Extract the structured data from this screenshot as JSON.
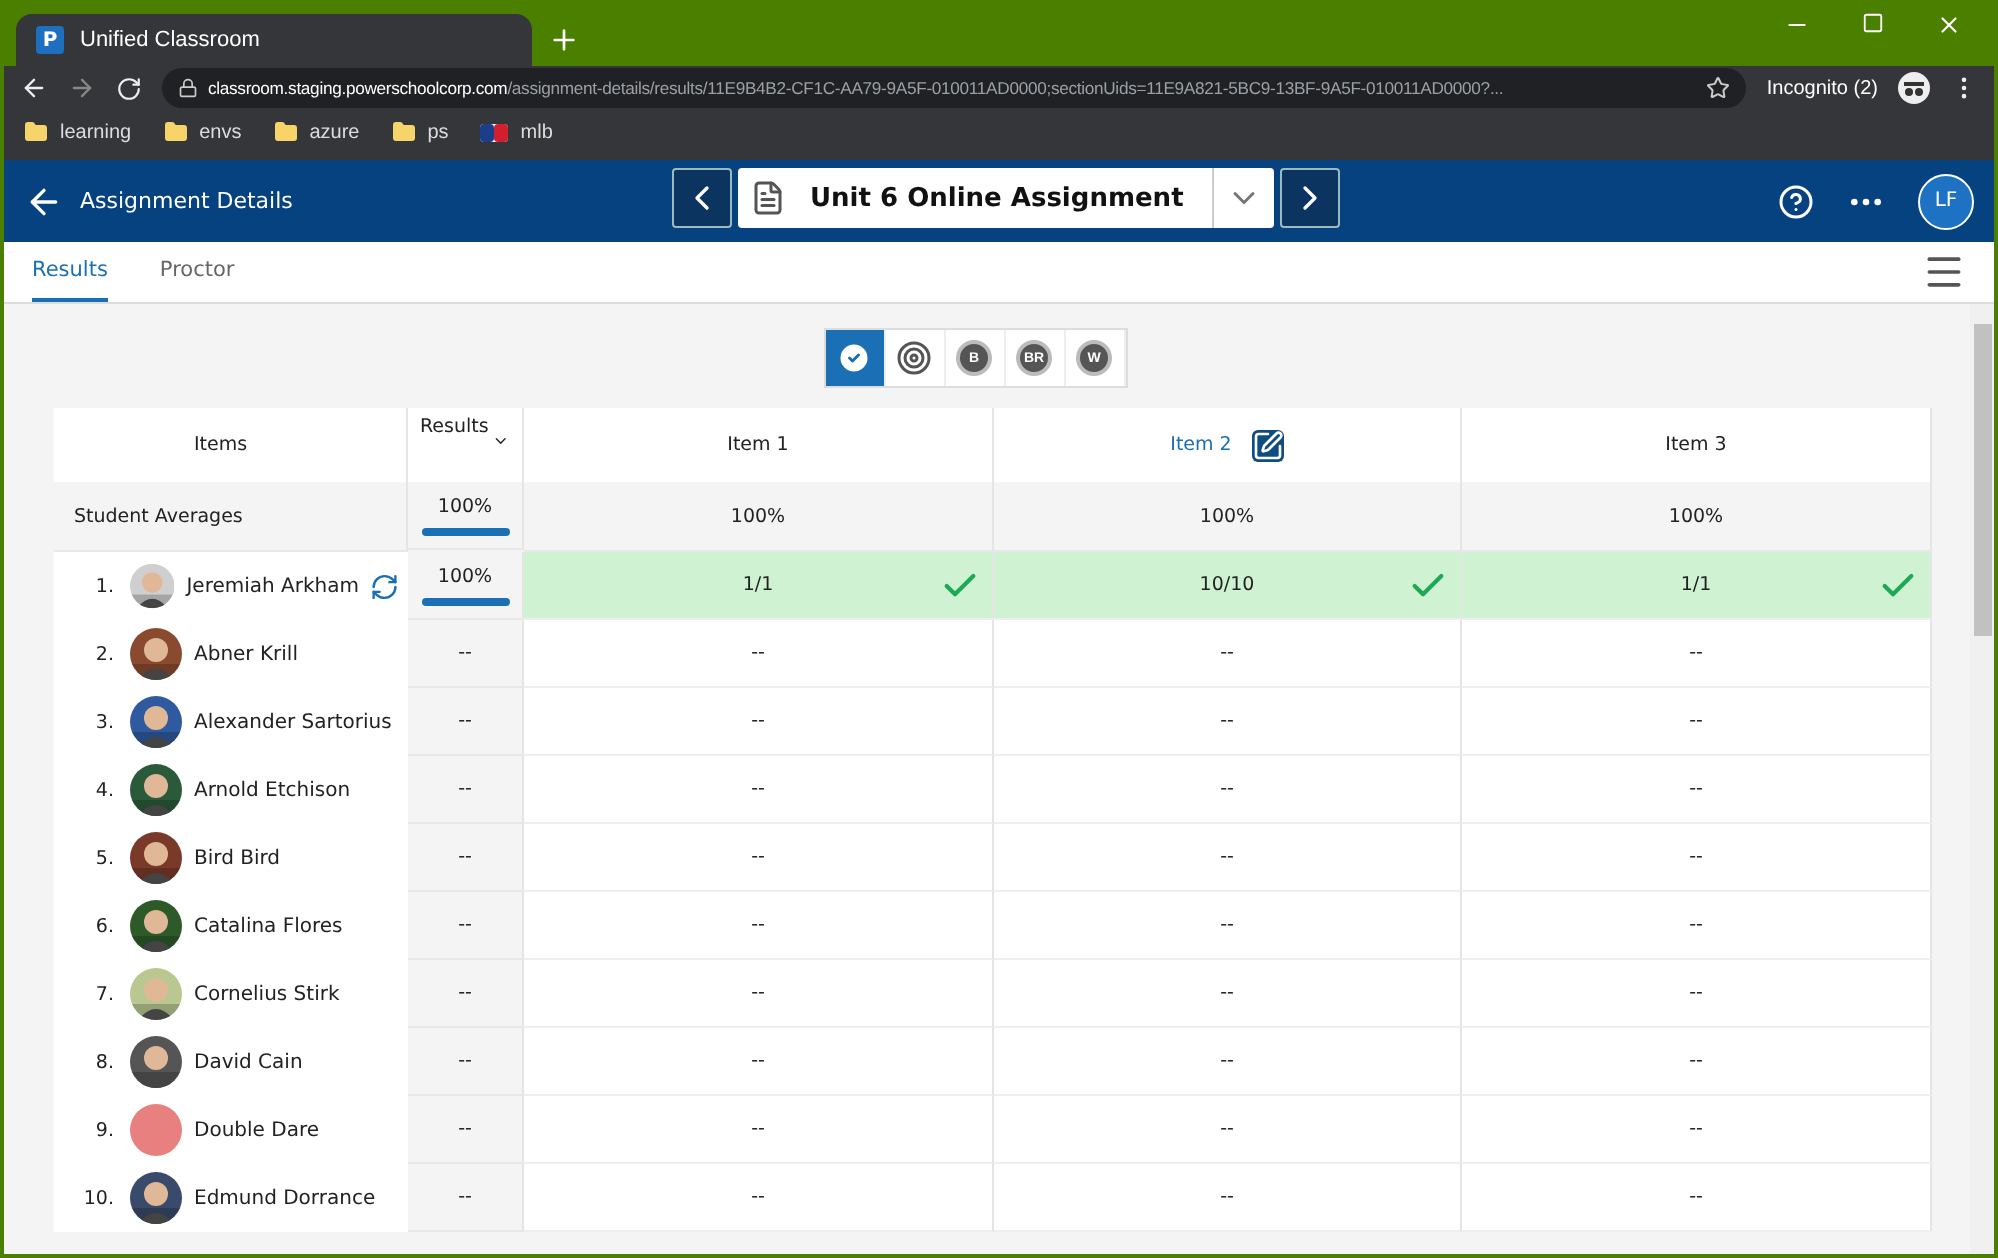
{
  "browser": {
    "tab_title": "Unified Classroom",
    "favicon": "P",
    "url_host": "classroom.staging.powerschoolcorp.com",
    "url_path": "/assignment-details/results/11E9B4B2-CF1C-AA79-9A5F-010011AD0000;sectionUids=11E9A821-5BC9-13BF-9A5F-010011AD0000?...",
    "incognito": "Incognito (2)",
    "bookmarks": [
      {
        "label": "learning",
        "kind": "folder"
      },
      {
        "label": "envs",
        "kind": "folder"
      },
      {
        "label": "azure",
        "kind": "folder"
      },
      {
        "label": "ps",
        "kind": "folder"
      },
      {
        "label": "mlb",
        "kind": "logo"
      }
    ]
  },
  "header": {
    "back_label": "Assignment Details",
    "assignment": "Unit 6 Online Assignment",
    "avatar": "LF"
  },
  "tabs": [
    {
      "label": "Results",
      "selected": true
    },
    {
      "label": "Proctor",
      "selected": false
    }
  ],
  "view_buttons": [
    {
      "kind": "check",
      "selected": true
    },
    {
      "kind": "target",
      "selected": false
    },
    {
      "kind": "letter",
      "label": "B",
      "selected": false
    },
    {
      "kind": "letter",
      "label": "BR",
      "selected": false
    },
    {
      "kind": "letter",
      "label": "W",
      "selected": false
    }
  ],
  "table": {
    "columns": [
      {
        "kind": "number"
      },
      {
        "label": "Items"
      },
      {
        "label": "Results"
      },
      {
        "label": "Item 1",
        "editable": false
      },
      {
        "label": "Item 2",
        "editable": true
      },
      {
        "label": "Item 3",
        "editable": false
      }
    ],
    "averages": {
      "label": "Student Averages",
      "result": "100%",
      "level": 1,
      "items": [
        "100%",
        "100%",
        "100%"
      ]
    },
    "rows": [
      {
        "number": "1.",
        "name": "Jeremiah Arkham",
        "retry": true,
        "result": "100%",
        "level": 1,
        "completed": true,
        "cells": [
          {
            "score": "1/1",
            "correct": true
          },
          {
            "score": "10/10",
            "correct": true
          },
          {
            "score": "1/1",
            "correct": true
          }
        ]
      },
      {
        "number": "2.",
        "name": "Abner Krill",
        "retry": false,
        "result": "--",
        "completed": false,
        "cells": [
          {
            "score": "--",
            "correct": false
          },
          {
            "score": "--",
            "correct": false
          },
          {
            "score": "--",
            "correct": false
          }
        ]
      },
      {
        "number": "3.",
        "name": "Alexander Sartorius",
        "retry": false,
        "result": "--",
        "completed": false,
        "cells": [
          {
            "score": "--",
            "correct": false
          },
          {
            "score": "--",
            "correct": false
          },
          {
            "score": "--",
            "correct": false
          }
        ]
      },
      {
        "number": "4.",
        "name": "Arnold Etchison",
        "retry": false,
        "result": "--",
        "completed": false,
        "cells": [
          {
            "score": "--",
            "correct": false
          },
          {
            "score": "--",
            "correct": false
          },
          {
            "score": "--",
            "correct": false
          }
        ]
      },
      {
        "number": "5.",
        "name": "Bird Bird",
        "retry": false,
        "result": "--",
        "completed": false,
        "cells": [
          {
            "score": "--",
            "correct": false
          },
          {
            "score": "--",
            "correct": false
          },
          {
            "score": "--",
            "correct": false
          }
        ]
      },
      {
        "number": "6.",
        "name": "Catalina Flores",
        "retry": false,
        "result": "--",
        "completed": false,
        "cells": [
          {
            "score": "--",
            "correct": false
          },
          {
            "score": "--",
            "correct": false
          },
          {
            "score": "--",
            "correct": false
          }
        ]
      },
      {
        "number": "7.",
        "name": "Cornelius Stirk",
        "retry": false,
        "result": "--",
        "completed": false,
        "cells": [
          {
            "score": "--",
            "correct": false
          },
          {
            "score": "--",
            "correct": false
          },
          {
            "score": "--",
            "correct": false
          }
        ]
      },
      {
        "number": "8.",
        "name": "David Cain",
        "retry": false,
        "result": "--",
        "completed": false,
        "cells": [
          {
            "score": "--",
            "correct": false
          },
          {
            "score": "--",
            "correct": false
          },
          {
            "score": "--",
            "correct": false
          }
        ]
      },
      {
        "number": "9.",
        "name": "Double Dare",
        "retry": false,
        "result": "--",
        "completed": false,
        "cells": [
          {
            "score": "--",
            "correct": false
          },
          {
            "score": "--",
            "correct": false
          },
          {
            "score": "--",
            "correct": false
          }
        ],
        "color": "#e88080"
      },
      {
        "number": "10.",
        "name": "Edmund Dorrance",
        "retry": false,
        "result": "--",
        "completed": false,
        "cells": [
          {
            "score": "--",
            "correct": false
          },
          {
            "score": "--",
            "correct": false
          },
          {
            "score": "--",
            "correct": false
          }
        ]
      }
    ]
  }
}
